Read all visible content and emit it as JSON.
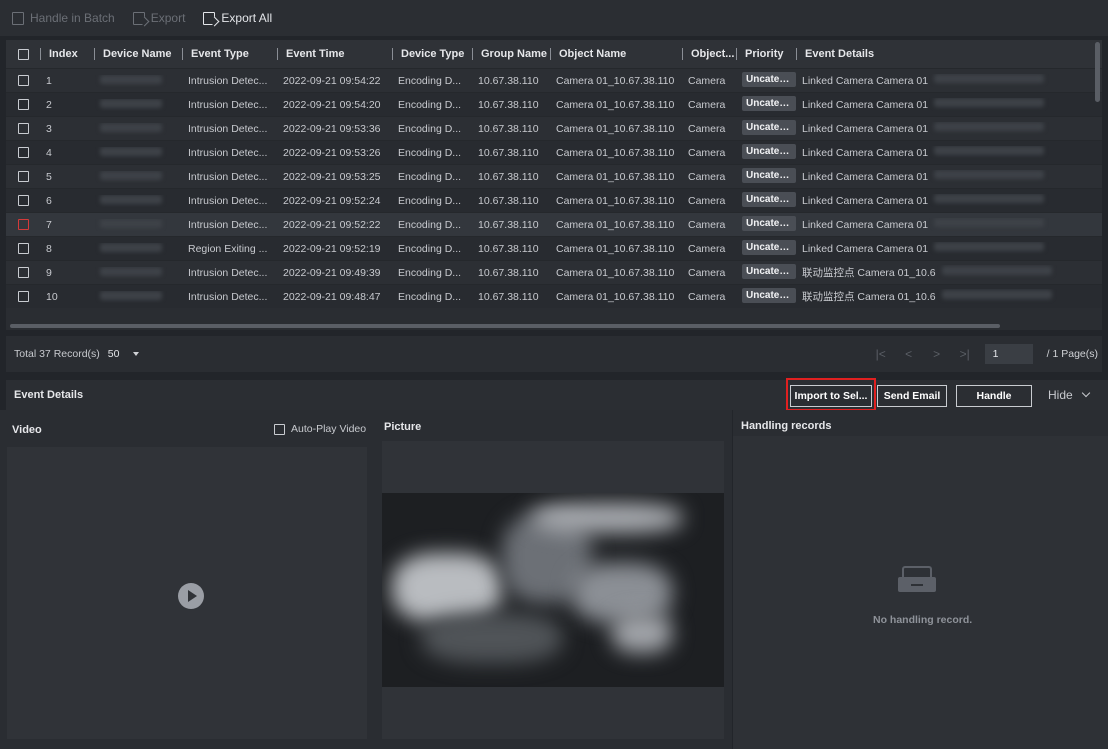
{
  "toolbar": {
    "handle_batch": "Handle in Batch",
    "export": "Export",
    "export_all": "Export All"
  },
  "table": {
    "columns": [
      "Index",
      "Device Name",
      "Event Type",
      "Event Time",
      "Device Type",
      "Group Name",
      "Object Name",
      "Object...",
      "Priority",
      "Event Details"
    ],
    "rows": [
      {
        "index": "1",
        "type": "Intrusion Detec...",
        "time": "2022-09-21 09:54:22",
        "dtype": "Encoding D...",
        "group": "10.67.38.110",
        "obj": "Camera 01_10.67.38.110",
        "otype": "Camera",
        "prio": "Uncateg...",
        "details": "Linked Camera Camera 01"
      },
      {
        "index": "2",
        "type": "Intrusion Detec...",
        "time": "2022-09-21 09:54:20",
        "dtype": "Encoding D...",
        "group": "10.67.38.110",
        "obj": "Camera 01_10.67.38.110",
        "otype": "Camera",
        "prio": "Uncateg...",
        "details": "Linked Camera Camera 01"
      },
      {
        "index": "3",
        "type": "Intrusion Detec...",
        "time": "2022-09-21 09:53:36",
        "dtype": "Encoding D...",
        "group": "10.67.38.110",
        "obj": "Camera 01_10.67.38.110",
        "otype": "Camera",
        "prio": "Uncateg...",
        "details": "Linked Camera Camera 01"
      },
      {
        "index": "4",
        "type": "Intrusion Detec...",
        "time": "2022-09-21 09:53:26",
        "dtype": "Encoding D...",
        "group": "10.67.38.110",
        "obj": "Camera 01_10.67.38.110",
        "otype": "Camera",
        "prio": "Uncateg...",
        "details": "Linked Camera Camera 01"
      },
      {
        "index": "5",
        "type": "Intrusion Detec...",
        "time": "2022-09-21 09:53:25",
        "dtype": "Encoding D...",
        "group": "10.67.38.110",
        "obj": "Camera 01_10.67.38.110",
        "otype": "Camera",
        "prio": "Uncateg...",
        "details": "Linked Camera Camera 01"
      },
      {
        "index": "6",
        "type": "Intrusion Detec...",
        "time": "2022-09-21 09:52:24",
        "dtype": "Encoding D...",
        "group": "10.67.38.110",
        "obj": "Camera 01_10.67.38.110",
        "otype": "Camera",
        "prio": "Uncateg...",
        "details": "Linked Camera Camera 01"
      },
      {
        "index": "7",
        "type": "Intrusion Detec...",
        "time": "2022-09-21 09:52:22",
        "dtype": "Encoding D...",
        "group": "10.67.38.110",
        "obj": "Camera 01_10.67.38.110",
        "otype": "Camera",
        "prio": "Uncateg...",
        "details": "Linked Camera Camera 01"
      },
      {
        "index": "8",
        "type": "Region Exiting ...",
        "time": "2022-09-21 09:52:19",
        "dtype": "Encoding D...",
        "group": "10.67.38.110",
        "obj": "Camera 01_10.67.38.110",
        "otype": "Camera",
        "prio": "Uncateg...",
        "details": "Linked Camera Camera 01"
      },
      {
        "index": "9",
        "type": "Intrusion Detec...",
        "time": "2022-09-21 09:49:39",
        "dtype": "Encoding D...",
        "group": "10.67.38.110",
        "obj": "Camera 01_10.67.38.110",
        "otype": "Camera",
        "prio": "Uncateg...",
        "details": "联动监控点 Camera 01_10.6"
      },
      {
        "index": "10",
        "type": "Intrusion Detec...",
        "time": "2022-09-21 09:48:47",
        "dtype": "Encoding D...",
        "group": "10.67.38.110",
        "obj": "Camera 01_10.67.38.110",
        "otype": "Camera",
        "prio": "Uncateg...",
        "details": "联动监控点 Camera 01_10.6"
      }
    ]
  },
  "pager": {
    "total": "Total 37 Record(s)",
    "page_size": "50",
    "page": "1",
    "of_pages": "/ 1 Page(s)",
    "first": "|<",
    "prev": "<",
    "next": ">",
    "last": ">|"
  },
  "details": {
    "title": "Event Details",
    "import_btn": "Import to Sel...",
    "email_btn": "Send Email",
    "handle_btn": "Handle",
    "hide": "Hide",
    "video_title": "Video",
    "autoplay": "Auto-Play Video",
    "picture_title": "Picture",
    "records_title": "Handling records",
    "no_record": "No handling record."
  },
  "colors": {
    "highlight": "#e02020",
    "background": "#22252a"
  }
}
